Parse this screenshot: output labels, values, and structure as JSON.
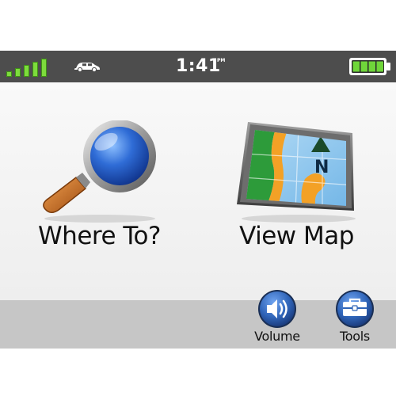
{
  "status_bar": {
    "signal_icon": "gps-signal-bars-icon",
    "signal_bars": 5,
    "vehicle_icon": "car-icon",
    "time": "1:41",
    "ampm": "PM",
    "battery_icon": "battery-icon",
    "battery_cells": 4
  },
  "main": {
    "where_to": {
      "label": "Where To?",
      "icon": "magnifying-glass-icon"
    },
    "view_map": {
      "label": "View Map",
      "icon": "map-icon",
      "compass_label": "N"
    }
  },
  "bottom_bar": {
    "volume": {
      "label": "Volume",
      "icon": "speaker-icon"
    },
    "tools": {
      "label": "Tools",
      "icon": "toolbox-icon"
    }
  },
  "colors": {
    "status_bar": "#4d4d4d",
    "signal_green": "#7ddc3c",
    "bottom_bar": "#c6c6c6",
    "button_blue": "#2f64b8"
  }
}
